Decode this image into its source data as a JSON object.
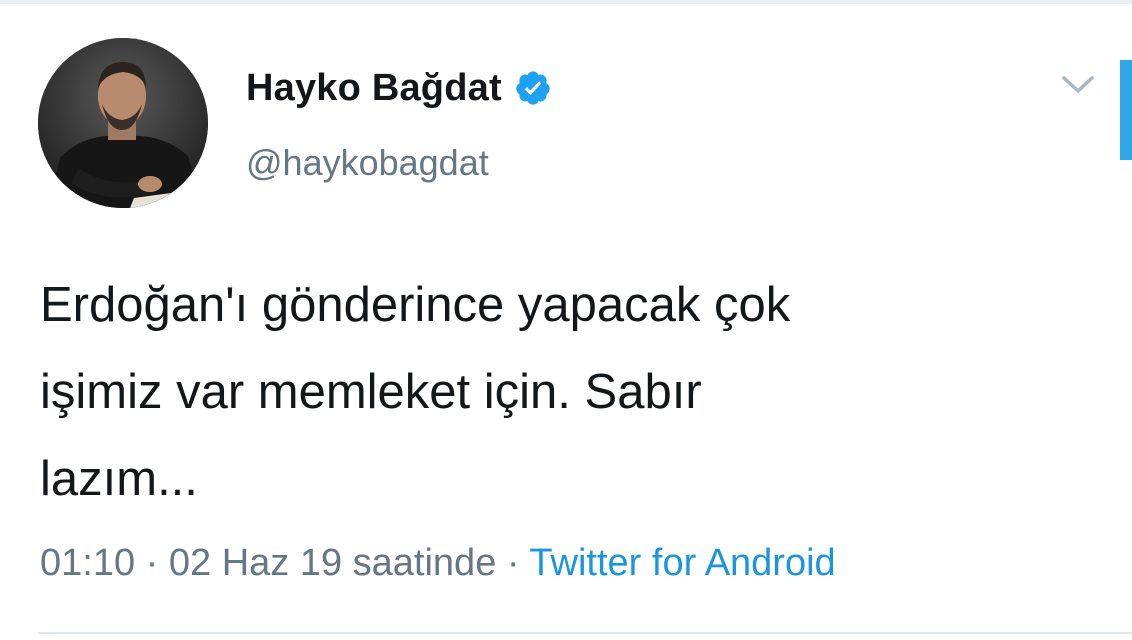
{
  "tweet": {
    "display_name": "Hayko Bağdat",
    "handle": "@haykobagdat",
    "verified": true,
    "text": "Erdoğan'ı gönderince yapacak çok\nişimiz var memleket için. Sabır\nlazım...",
    "time": "01:10",
    "separator": "·",
    "date": "02 Haz 19 saatinde",
    "source": "Twitter for Android"
  },
  "icons": {
    "verified": "verified-badge-icon",
    "menu": "chevron-down-icon"
  },
  "colors": {
    "text_primary": "#14171a",
    "text_secondary": "#657786",
    "accent": "#1b95e0",
    "verified_badge": "#1da1f2",
    "scrollbar": "#2fa7e6"
  }
}
